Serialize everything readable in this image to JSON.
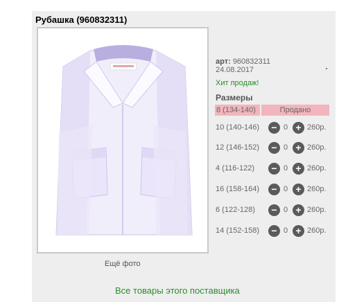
{
  "product": {
    "title": "Рубашка (960832311)",
    "art_label": "арт:",
    "art_value": "960832311",
    "date": "24.08.2017",
    "hit": "Хит продаж!",
    "sizes_title": "Размеры",
    "more_photo": "Ещё фото",
    "supplier_link": "Все товары этого поставщика"
  },
  "sold_out": {
    "size": "8 (134-140)",
    "status": "Продано"
  },
  "sizes": [
    {
      "size": "10 (140-146)",
      "qty": "0",
      "price": "260р."
    },
    {
      "size": "12 (146-152)",
      "qty": "0",
      "price": "260р."
    },
    {
      "size": "4 (116-122)",
      "qty": "0",
      "price": "260р."
    },
    {
      "size": "16 (158-164)",
      "qty": "0",
      "price": "260р."
    },
    {
      "size": "6 (122-128)",
      "qty": "0",
      "price": "260р."
    },
    {
      "size": "14 (152-158)",
      "qty": "0",
      "price": "260р."
    }
  ],
  "controls": {
    "minus": "−",
    "plus": "+"
  }
}
